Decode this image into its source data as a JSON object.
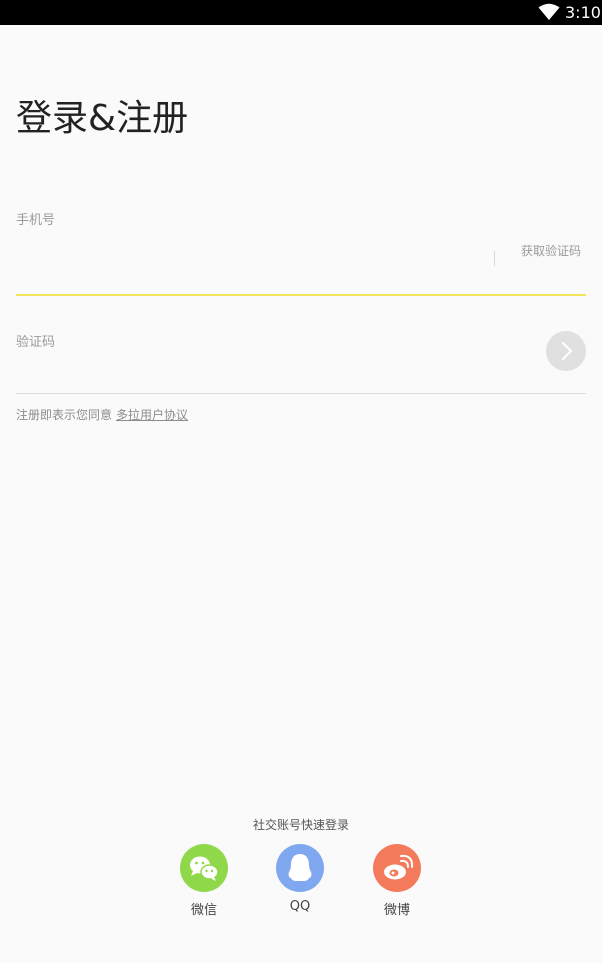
{
  "status_bar": {
    "time": "3:10",
    "wifi_icon": "wifi-icon"
  },
  "page": {
    "title": "登录&注册"
  },
  "form": {
    "phone_label": "手机号",
    "phone_value": "",
    "get_code_label": "获取验证码",
    "code_label": "验证码",
    "code_value": "",
    "next_icon": "chevron-right-icon"
  },
  "agreement": {
    "prefix": "注册即表示您同意",
    "link": "多拉用户协议"
  },
  "social": {
    "title": "社交账号快速登录",
    "items": [
      {
        "label": "微信",
        "icon": "wechat-icon",
        "color": "#8fd849"
      },
      {
        "label": "QQ",
        "icon": "qq-icon",
        "color": "#7fa8f0"
      },
      {
        "label": "微博",
        "icon": "weibo-icon",
        "color": "#f47a5c"
      }
    ]
  },
  "colors": {
    "accent_line": "#f3e45a",
    "divider": "#dcdcdc",
    "next_button": "#e0e0e0"
  }
}
